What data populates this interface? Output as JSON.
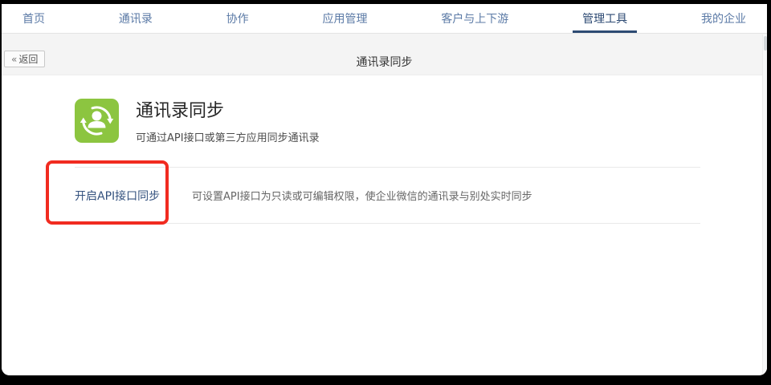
{
  "nav": {
    "items": [
      {
        "label": "首页",
        "active": false
      },
      {
        "label": "通讯录",
        "active": false
      },
      {
        "label": "协作",
        "active": false
      },
      {
        "label": "应用管理",
        "active": false
      },
      {
        "label": "客户与上下游",
        "active": false
      },
      {
        "label": "管理工具",
        "active": true
      },
      {
        "label": "我的企业",
        "active": false
      }
    ]
  },
  "subheader": {
    "back_icon": "«",
    "back_label": "返回",
    "title": "通讯录同步"
  },
  "main": {
    "app": {
      "icon": "contacts-sync-icon",
      "icon_color": "#8CC540",
      "title": "通讯录同步",
      "subtitle": "可通过API接口或第三方应用同步通讯录"
    },
    "rows": [
      {
        "link": "开启API接口同步",
        "description": "可设置API接口为只读或可编辑权限，使企业微信的通讯录与别处实时同步"
      }
    ]
  },
  "annotation": {
    "shape": "red-rectangle-highlight",
    "color": "#F12B20"
  },
  "colors": {
    "nav_link": "#5B7AA6",
    "nav_active": "#2D4A73",
    "content_link": "#33517E"
  }
}
